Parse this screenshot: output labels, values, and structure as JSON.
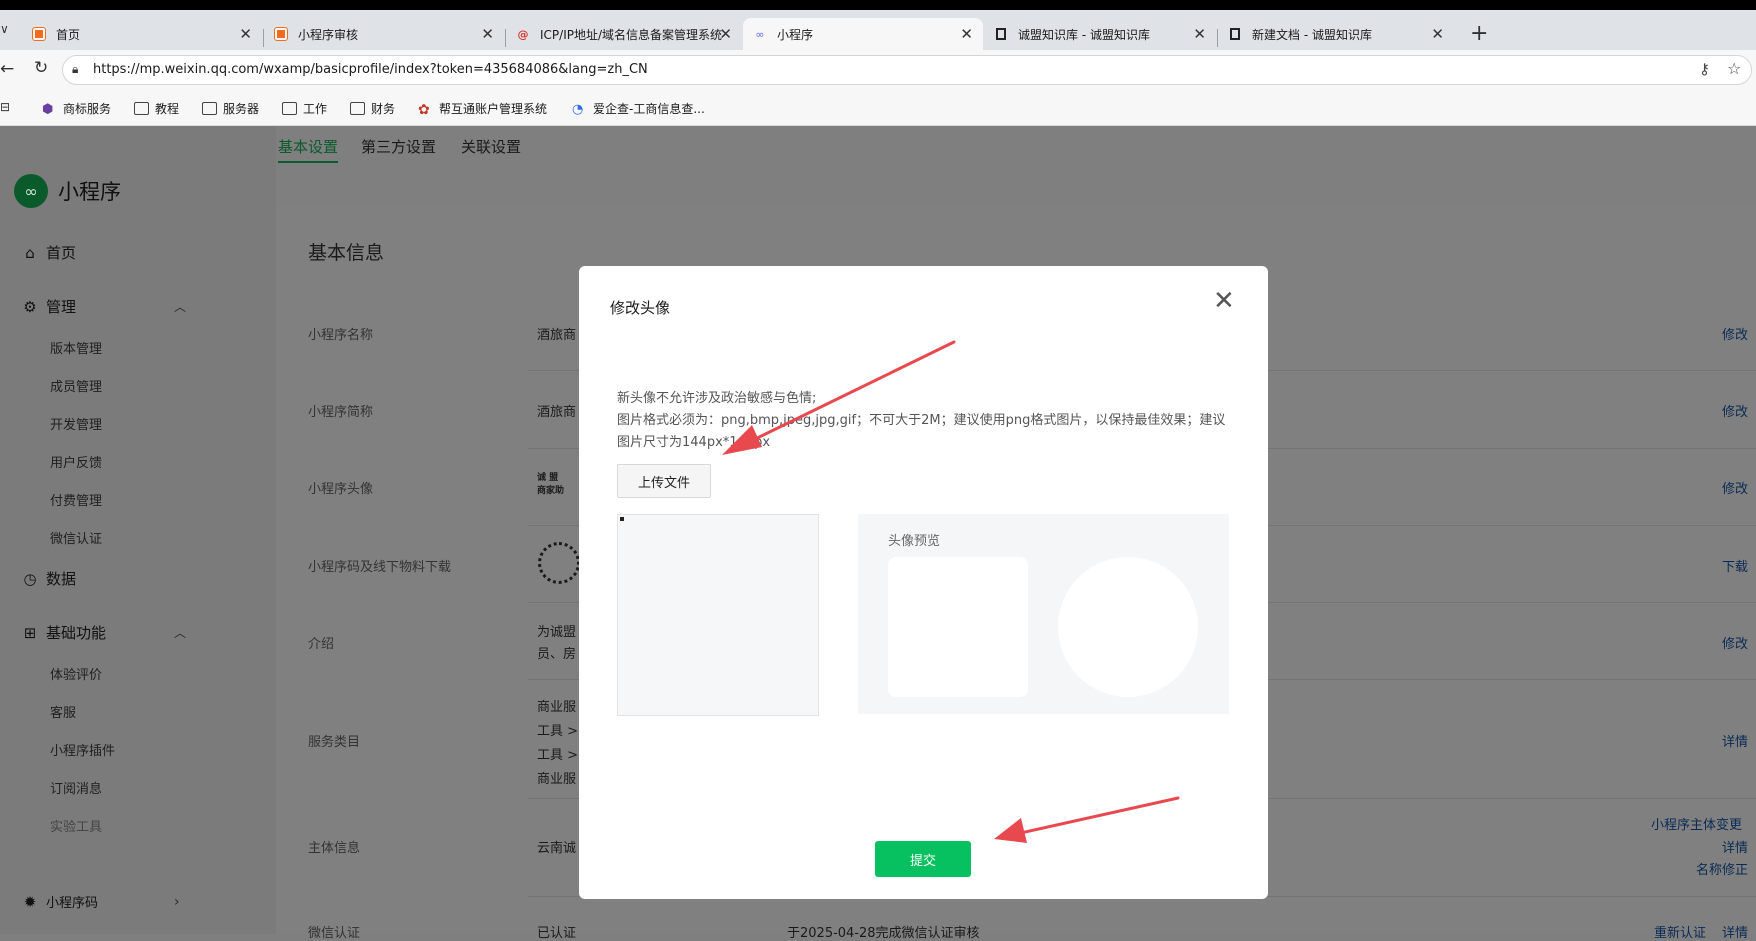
{
  "browser": {
    "tabs": [
      {
        "title": "首页",
        "favicon": "orange-square-icon"
      },
      {
        "title": "小程序审核",
        "favicon": "orange-square-icon"
      },
      {
        "title": "ICP/IP地址/域名信息备案管理系统",
        "favicon": "icp-logo-icon"
      },
      {
        "title": "小程序",
        "favicon": "miniprogram-icon"
      },
      {
        "title": "诚盟知识库 - 诚盟知识库",
        "favicon": "doc-icon"
      },
      {
        "title": "新建文档 - 诚盟知识库",
        "favicon": "doc-icon"
      }
    ],
    "url": "https://mp.weixin.qq.com/wxamp/basicprofile/index?token=435684086&lang=zh_CN",
    "bookmarks": [
      "商标服务",
      "教程",
      "服务器",
      "工作",
      "财务",
      "帮互通账户管理系统",
      "爱企查-工商信息查..."
    ]
  },
  "subnav": {
    "tabs": [
      "基本设置",
      "第三方设置",
      "关联设置"
    ]
  },
  "sidebar": {
    "brand": "小程序",
    "items": [
      {
        "label": "首页",
        "icon": "home-icon"
      },
      {
        "label": "管理",
        "icon": "settings-icon"
      },
      {
        "label": "数据",
        "icon": "chart-icon"
      },
      {
        "label": "基础功能",
        "icon": "grid-icon"
      },
      {
        "label": "小程序码",
        "icon": "sun-icon"
      }
    ],
    "manage_sub": [
      "版本管理",
      "成员管理",
      "开发管理",
      "用户反馈",
      "付费管理",
      "微信认证"
    ],
    "basic_sub": [
      "体验评价",
      "客服",
      "小程序插件",
      "订阅消息",
      "实验工具"
    ]
  },
  "content": {
    "section_title": "基本信息",
    "rows": [
      {
        "label": "小程序名称",
        "value": "酒旅商",
        "action": "修改"
      },
      {
        "label": "小程序简称",
        "value": "酒旅商",
        "action": "修改"
      },
      {
        "label": "小程序头像",
        "value": "诚 盟\n商家助",
        "action": "修改"
      },
      {
        "label": "小程序码及线下物料下载",
        "value": "",
        "action": "下载"
      },
      {
        "label": "介绍",
        "value": "为诚盟\n员、房",
        "action": "修改"
      },
      {
        "label": "服务类目",
        "value": "商业服\n工具 >\n工具 >\n商业服",
        "action": "详情"
      },
      {
        "label": "主体信息",
        "value": "云南诚",
        "actions": [
          "小程序主体变更",
          "详情",
          "名称修正"
        ]
      },
      {
        "label": "微信认证",
        "value": "已认证",
        "extra": "于2025-04-28完成微信认证审核",
        "actions": [
          "重新认证",
          "详情"
        ]
      }
    ]
  },
  "modal": {
    "title": "修改头像",
    "note_line1": "新头像不允许涉及政治敏感与色情;",
    "note_line2": "图片格式必须为：png,bmp,jpeg,jpg,gif；不可大于2M；建议使用png格式图片，以保持最佳效果；建议图片尺寸为144px*144px",
    "upload_label": "上传文件",
    "preview_label": "头像预览",
    "submit_label": "提交"
  },
  "colors": {
    "accent": "#07c160",
    "annotation_arrow": "#e8494f"
  }
}
